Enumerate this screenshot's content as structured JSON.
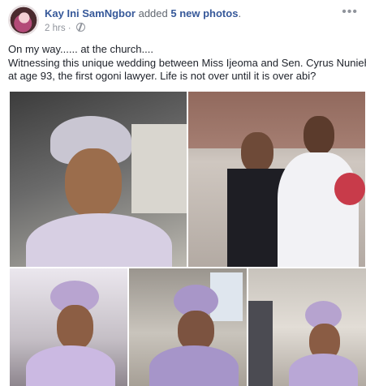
{
  "post": {
    "author": "Kay Ini SamNgbor",
    "action_prefix": "added",
    "action_count": "5 new photos",
    "action_suffix": ".",
    "time": "2 hrs",
    "separator": "·",
    "options_label": "•••",
    "text_lines": [
      "On my way...... at the church....",
      "Witnessing this unique wedding between Miss Ijeoma and Sen. Cyrus Nunieh,",
      "at age 93, the first ogoni lawyer. Life is not over until it is over abi?"
    ]
  },
  "photos": [
    {
      "icon": "photo-woman-in-car"
    },
    {
      "icon": "photo-wedding-couple"
    },
    {
      "icon": "photo-woman-purple-headwrap"
    },
    {
      "icon": "photo-woman-in-church"
    },
    {
      "icon": "photo-woman-in-hall"
    }
  ],
  "colors": {
    "link": "#365899",
    "meta": "#90949c",
    "text": "#1d2129"
  }
}
